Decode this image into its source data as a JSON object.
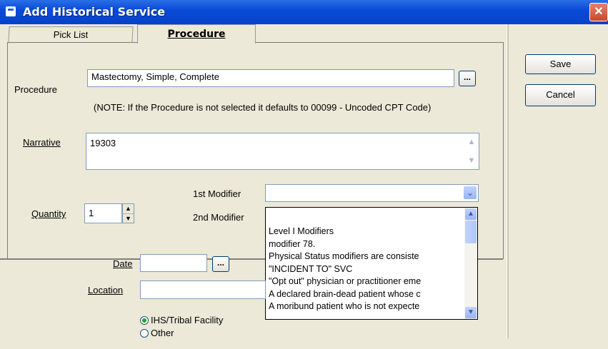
{
  "window": {
    "title": "Add Historical Service",
    "close_symbol": "✕"
  },
  "tabs": [
    {
      "label": "Pick List",
      "access_key": "k"
    },
    {
      "label": "Procedure",
      "access_key": "P"
    }
  ],
  "procedure": {
    "label": "Procedure",
    "value": "Mastectomy, Simple, Complete",
    "browse_label": "...",
    "note": "(NOTE: If the Procedure is not selected it defaults to 00099 - Uncoded CPT Code)"
  },
  "narrative": {
    "label": "Narrative",
    "value": "19303"
  },
  "quantity": {
    "label": "Quantity",
    "value": "1"
  },
  "modifier1": {
    "label": "1st Modifier",
    "value": ""
  },
  "modifier2": {
    "label": "2nd Modifier",
    "options": [
      "Level I Modifiers",
      "modifier 78.",
      " Physical Status modifiers are consiste",
      "\"INCIDENT TO\" SVC",
      "\"Opt out\" physician or practitioner eme",
      "A declared brain-dead patient whose c",
      "A moribund patient who is not expecte"
    ]
  },
  "date": {
    "label": "Date",
    "value": "",
    "browse_label": "..."
  },
  "location": {
    "label": "Location",
    "value": ""
  },
  "facility_options": [
    {
      "label": "IHS/Tribal Facility",
      "selected": true
    },
    {
      "label": "Other",
      "selected": false
    }
  ],
  "actions": {
    "save": "Save",
    "cancel": "Cancel"
  }
}
